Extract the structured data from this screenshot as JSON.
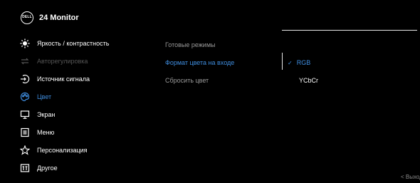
{
  "header": {
    "logo": "DELL",
    "title": "24 Monitor"
  },
  "menu": [
    {
      "label": "Яркость / контрастность",
      "icon": "brightness-icon",
      "state": "normal"
    },
    {
      "label": "Авторегулировка",
      "icon": "auto-adjust-icon",
      "state": "disabled"
    },
    {
      "label": "Источник сигнала",
      "icon": "input-source-icon",
      "state": "normal"
    },
    {
      "label": "Цвет",
      "icon": "color-icon",
      "state": "active"
    },
    {
      "label": "Экран",
      "icon": "display-icon",
      "state": "normal"
    },
    {
      "label": "Меню",
      "icon": "menu-icon",
      "state": "normal"
    },
    {
      "label": "Персонализация",
      "icon": "star-icon",
      "state": "normal"
    },
    {
      "label": "Другое",
      "icon": "other-icon",
      "state": "normal"
    }
  ],
  "submenu": [
    {
      "label": "Готовые режимы"
    },
    {
      "label": "Формат цвета на входе"
    },
    {
      "label": "Сбросить цвет"
    }
  ],
  "options": [
    {
      "label": "RGB",
      "selected": true,
      "check": "✓"
    },
    {
      "label": "YCbCr",
      "selected": false
    }
  ],
  "footer": {
    "exit": "< Выход"
  },
  "colors": {
    "accent": "#3f8ddf",
    "disabled": "#555555",
    "sub": "#9a9a9a"
  }
}
